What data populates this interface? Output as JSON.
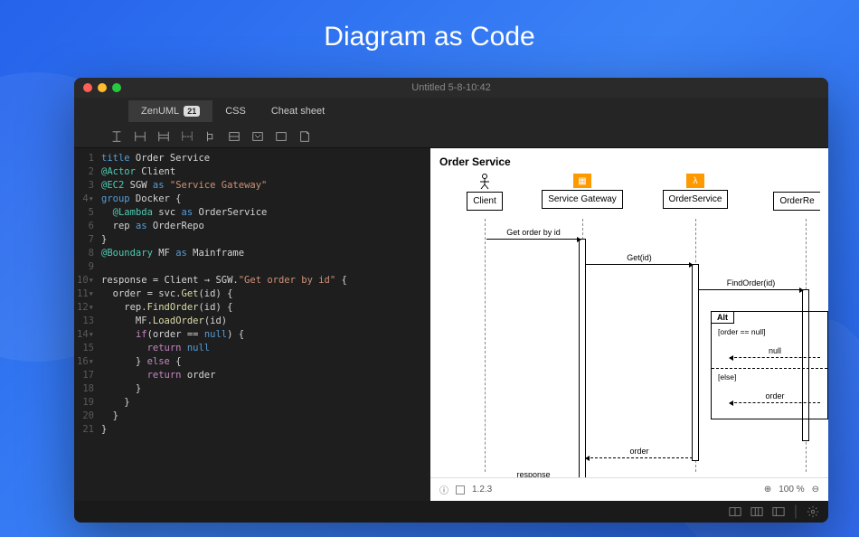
{
  "hero": {
    "title": "Diagram as Code"
  },
  "window": {
    "title": "Untitled 5-8-10:42"
  },
  "tabs": {
    "zenuml": "ZenUML",
    "zenuml_badge": "21",
    "css": "CSS",
    "cheat": "Cheat sheet"
  },
  "code": {
    "lines": [
      {
        "n": "1",
        "html": "<span class='kw2'>title</span> Order Service"
      },
      {
        "n": "2",
        "html": "<span class='id2'>@Actor</span> Client"
      },
      {
        "n": "3",
        "html": "<span class='id2'>@EC2</span> SGW <span class='kw2'>as</span> <span class='str'>\"Service Gateway\"</span>"
      },
      {
        "n": "4▾",
        "html": "<span class='kw2'>group</span> Docker {"
      },
      {
        "n": "5",
        "html": "  <span class='id2'>@Lambda</span> svc <span class='kw2'>as</span> OrderService"
      },
      {
        "n": "6",
        "html": "  rep <span class='kw2'>as</span> OrderRepo"
      },
      {
        "n": "7",
        "html": "}"
      },
      {
        "n": "8",
        "html": "<span class='id2'>@Boundary</span> MF <span class='kw2'>as</span> Mainframe"
      },
      {
        "n": "9",
        "html": ""
      },
      {
        "n": "10▾",
        "html": "response = Client <span class='op'>→</span> SGW.<span class='str'>\"Get order by id\"</span> {"
      },
      {
        "n": "11▾",
        "html": "  order = svc.<span class='fn'>Get</span>(id) {"
      },
      {
        "n": "12▾",
        "html": "    rep.<span class='fn'>FindOrder</span>(id) {"
      },
      {
        "n": "13",
        "html": "      MF.<span class='fn'>LoadOrder</span>(id)"
      },
      {
        "n": "14▾",
        "html": "      <span class='kw'>if</span>(order <span class='op'>==</span> <span class='null'>null</span>) {"
      },
      {
        "n": "15",
        "html": "        <span class='ret'>return</span> <span class='null'>null</span>"
      },
      {
        "n": "16▾",
        "html": "      } <span class='kw'>else</span> {"
      },
      {
        "n": "17",
        "html": "        <span class='ret'>return</span> order"
      },
      {
        "n": "18",
        "html": "      }"
      },
      {
        "n": "19",
        "html": "    }"
      },
      {
        "n": "20",
        "html": "  }"
      },
      {
        "n": "21",
        "html": "}"
      }
    ]
  },
  "diagram": {
    "title": "Order Service",
    "participants": {
      "client": "Client",
      "gateway": "Service Gateway",
      "service": "OrderService",
      "repo": "OrderRe"
    },
    "messages": {
      "get_order": "Get order by id",
      "get": "Get(id)",
      "find": "FindOrder(id)",
      "alt": "Alt",
      "guard1": "[order == null]",
      "guard2": "[else]",
      "ret_null": "null",
      "ret_order": "order",
      "order": "order",
      "response": "response"
    }
  },
  "footer": {
    "numbering": "1.2.3",
    "zoom": "100 %"
  }
}
